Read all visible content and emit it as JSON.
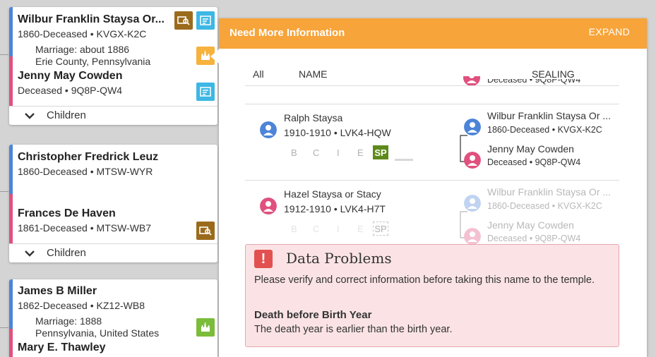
{
  "tree": {
    "children_label": "Children",
    "families": [
      {
        "husband": {
          "name": "Wilbur Franklin Staysa Or...",
          "info": "1860-Deceased • KVGX-K2C"
        },
        "marriage": {
          "line1": "Marriage: about 1886",
          "line2": "Erie County, Pennsylvania"
        },
        "wife": {
          "name": "Jenny May Cowden",
          "info": "Deceased • 9Q8P-QW4"
        }
      },
      {
        "husband": {
          "name": "Christopher Fredrick Leuz",
          "info": "1860-Deceased • MTSW-WYR"
        },
        "wife": {
          "name": "Frances De Haven",
          "info": "1861-Deceased • MTSW-WB7"
        }
      },
      {
        "husband": {
          "name": "James B Miller",
          "info": "1862-Deceased • KZ12-WB8"
        },
        "marriage": {
          "line1": "Marriage: 1888",
          "line2": "Pennsylvania, United States"
        },
        "wife": {
          "name": "Mary E. Thawley",
          "info": ""
        }
      }
    ]
  },
  "panel": {
    "title": "Need More Information",
    "expand": "EXPAND",
    "columns": {
      "all": "All",
      "name": "NAME",
      "sealing": "SEALING"
    },
    "partial_row_text": "Deceased • 9Q8P-QW4",
    "rows": [
      {
        "name": "Ralph Staysa",
        "info": "1910-1910 • LVK4-HQW",
        "ordinances": [
          "B",
          "C",
          "I",
          "E",
          "SP"
        ],
        "father": {
          "name": "Wilbur Franklin Staysa Or ...",
          "info": "1860-Deceased • KVGX-K2C"
        },
        "mother": {
          "name": "Jenny May Cowden",
          "info": "Deceased • 9Q8P-QW4"
        }
      },
      {
        "name": "Hazel Staysa or Stacy",
        "info": "1912-1910 • LVK4-H7T",
        "ordinances": [
          "B",
          "C",
          "I",
          "E",
          "SP"
        ],
        "father": {
          "name": "Wilbur Franklin Staysa Or ...",
          "info": "1860-Deceased • KVGX-K2C"
        },
        "mother": {
          "name": "Jenny May Cowden",
          "info": "Deceased • 9Q8P-QW4"
        }
      }
    ],
    "problems": {
      "icon": "!",
      "title": "Data Problems",
      "description": "Please verify and correct information before taking this name to the temple.",
      "issue_title": "Death before Birth Year",
      "issue_description": "The death year is earlier than the birth year."
    }
  },
  "colors": {
    "header": "#f7a43a",
    "male": "#4c84d8",
    "female": "#e0517f",
    "sp_done": "#5d8a1a",
    "problem_bg": "#fbe3e5"
  }
}
